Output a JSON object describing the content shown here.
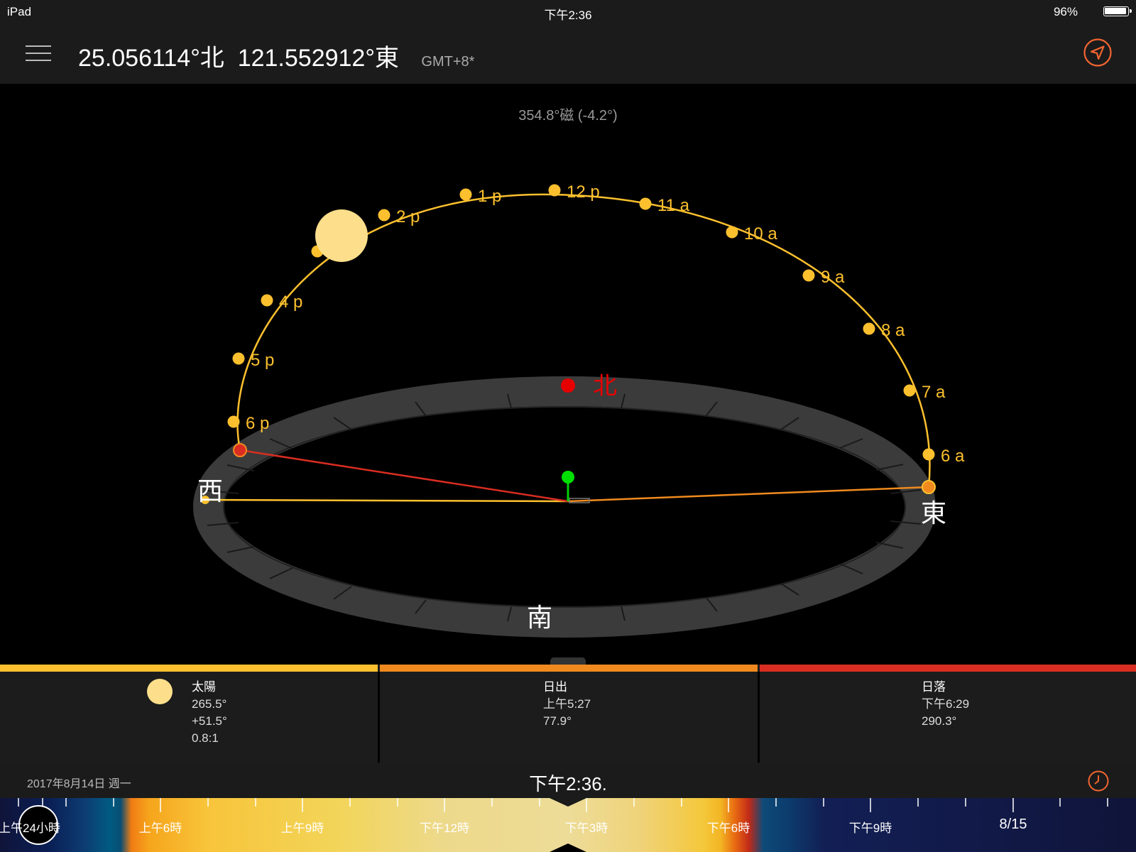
{
  "status_bar": {
    "device": "iPad",
    "time": "下午2:36",
    "battery": "96%"
  },
  "header": {
    "latitude": "25.056114°北",
    "longitude": "121.552912°東",
    "timezone": "GMT+8*"
  },
  "compass": {
    "heading": "354.8°磁 (-4.2°)",
    "north": "北",
    "south": "南",
    "east": "東",
    "west": "西"
  },
  "sun_path": {
    "hour_labels": [
      "6 a",
      "7 a",
      "8 a",
      "9 a",
      "10 a",
      "11 a",
      "12 p",
      "1 p",
      "2 p",
      "4 p",
      "5 p",
      "6 p"
    ]
  },
  "colors": {
    "sun": "#fddf8b",
    "path": "#fcc02e",
    "sunrise": "#f08a1f",
    "sunset": "#d92d21",
    "north": "#e60000",
    "marker": "#00e000",
    "accent": "#f26531"
  },
  "info": {
    "sun": {
      "title": "太陽",
      "azimuth": "265.5°",
      "altitude": "+51.5°",
      "ratio": "0.8:1"
    },
    "sunrise": {
      "title": "日出",
      "time": "上午5:27",
      "azimuth": "77.9°"
    },
    "sunset": {
      "title": "日落",
      "time": "下午6:29",
      "azimuth": "290.3°"
    }
  },
  "date_bar": {
    "date": "2017年8月14日 週一",
    "time": "下午2:36."
  },
  "timeline": {
    "button_label": "上午24小時",
    "labels": [
      "上午6時",
      "上午9時",
      "下午12時",
      "下午3時",
      "下午6時",
      "下午9時"
    ],
    "next_day": "8/15"
  }
}
